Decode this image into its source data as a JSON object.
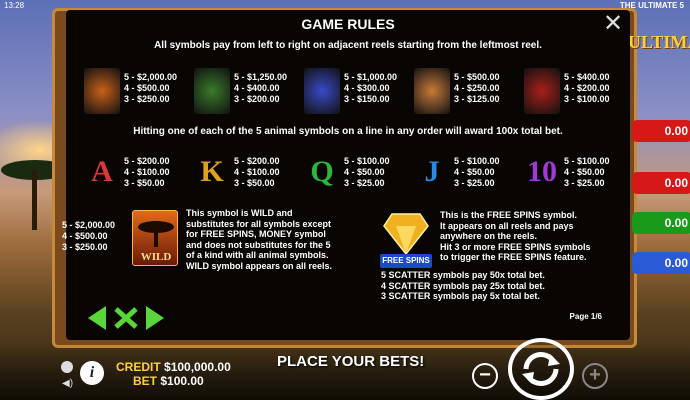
{
  "status_bar": {
    "time": "13:28",
    "game_name": "THE ULTIMATE 5"
  },
  "right_side": {
    "logo_text": "ULTIMATE",
    "values": [
      "0.00",
      "0.00",
      "0.00",
      "0.00"
    ],
    "colors": [
      "#d61818",
      "#d61818",
      "#1a9a1a",
      "#2a5ad6"
    ]
  },
  "rules": {
    "title": "GAME RULES",
    "intro": "All symbols pay from left to right on adjacent reels starting from the leftmost reel.",
    "animal_symbols": [
      {
        "name": "lion",
        "color": "#c8601a",
        "pays": [
          "5 - $2,000.00",
          "4 - $500.00",
          "3 - $250.00"
        ]
      },
      {
        "name": "leopard",
        "color": "#3a7a2a",
        "pays": [
          "5 - $1,250.00",
          "4 - $400.00",
          "3 - $200.00"
        ]
      },
      {
        "name": "elephant",
        "color": "#3a4ac8",
        "pays": [
          "5 - $1,000.00",
          "4 - $300.00",
          "3 - $150.00"
        ]
      },
      {
        "name": "rhino",
        "color": "#c87a3a",
        "pays": [
          "5 - $500.00",
          "4 - $250.00",
          "3 - $125.00"
        ]
      },
      {
        "name": "buffalo",
        "color": "#a8201a",
        "pays": [
          "5 - $400.00",
          "4 - $200.00",
          "3 - $100.00"
        ]
      }
    ],
    "animal_combo": "Hitting one of each of the 5 animal symbols on a line in any order will award 100x total bet.",
    "letter_symbols": [
      {
        "letter": "A",
        "color": "#d63a3a",
        "pays": [
          "5 - $200.00",
          "4 - $100.00",
          "3 - $50.00"
        ]
      },
      {
        "letter": "K",
        "color": "#e0a020",
        "pays": [
          "5 - $200.00",
          "4 - $100.00",
          "3 - $50.00"
        ]
      },
      {
        "letter": "Q",
        "color": "#2ab83a",
        "pays": [
          "5 - $100.00",
          "4 - $50.00",
          "3 - $25.00"
        ]
      },
      {
        "letter": "J",
        "color": "#2a8ae0",
        "pays": [
          "5 - $100.00",
          "4 - $50.00",
          "3 - $25.00"
        ]
      },
      {
        "letter": "10",
        "color": "#a03ad6",
        "pays": [
          "5 - $100.00",
          "4 - $50.00",
          "3 - $25.00"
        ]
      }
    ],
    "wild": {
      "pays": [
        "5 - $2,000.00",
        "4 - $500.00",
        "3 - $250.00"
      ],
      "label": "WILD",
      "desc": [
        "This symbol is WILD and",
        "substitutes for all symbols except",
        "for FREE SPINS, MONEY symbol",
        "and does not substitutes for the 5",
        "of a kind with all animal symbols.",
        "WILD symbol appears on all reels."
      ]
    },
    "free_spins": {
      "label": "FREE SPINS",
      "desc": [
        "This is the FREE SPINS symbol.",
        "It appears on all reels and pays",
        "anywhere on the reels.",
        "Hit 3 or more FREE SPINS symbols",
        "to trigger the FREE SPINS feature."
      ],
      "scatter": [
        "5 SCATTER symbols pay 50x total bet.",
        "4 SCATTER symbols pay 25x total bet.",
        "3 SCATTER symbols pay 5x total bet."
      ]
    },
    "page": "Page 1/6"
  },
  "bottom": {
    "credit_label": "CREDIT",
    "credit_value": "$100,000.00",
    "bet_label": "BET",
    "bet_value": "$100.00",
    "message": "PLACE YOUR BETS!"
  }
}
